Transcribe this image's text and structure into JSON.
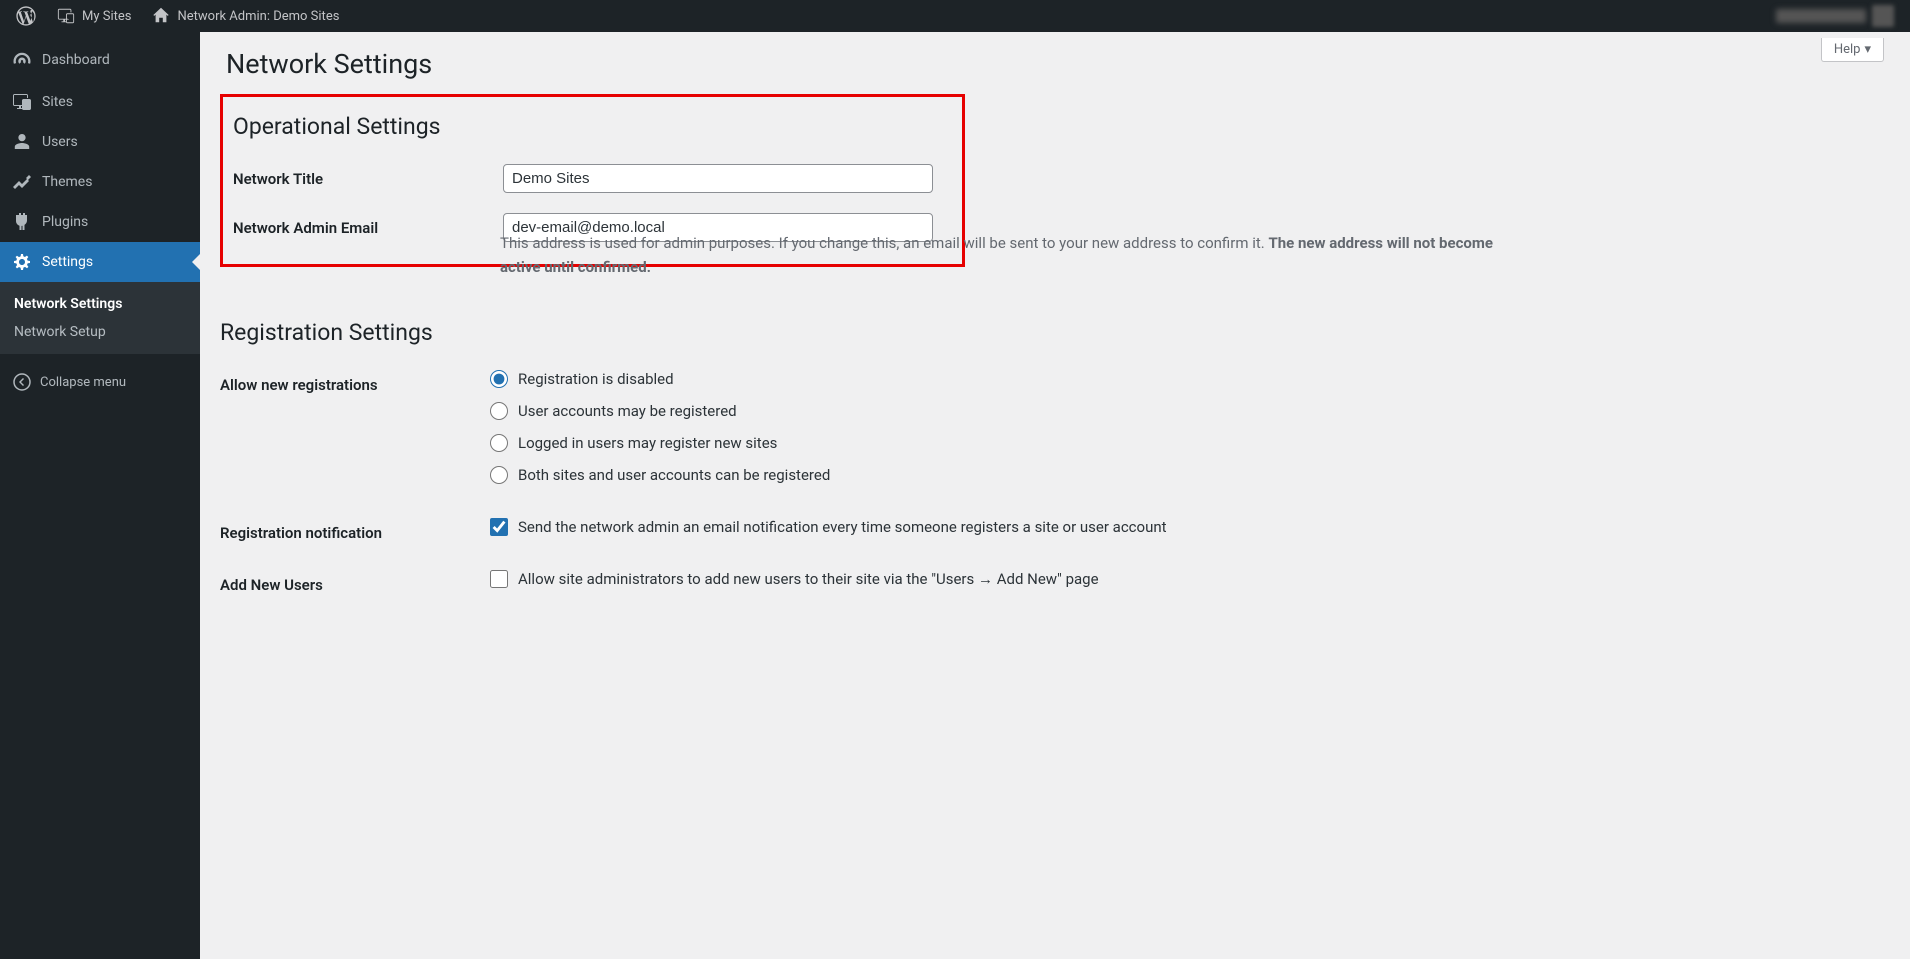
{
  "adminbar": {
    "my_sites": "My Sites",
    "network_admin": "Network Admin: Demo Sites"
  },
  "help_label": "Help",
  "sidebar": {
    "items": [
      {
        "label": "Dashboard"
      },
      {
        "label": "Sites"
      },
      {
        "label": "Users"
      },
      {
        "label": "Themes"
      },
      {
        "label": "Plugins"
      },
      {
        "label": "Settings"
      }
    ],
    "submenu": [
      {
        "label": "Network Settings"
      },
      {
        "label": "Network Setup"
      }
    ],
    "collapse": "Collapse menu"
  },
  "page": {
    "title": "Network Settings",
    "operational": {
      "heading": "Operational Settings",
      "network_title_label": "Network Title",
      "network_title_value": "Demo Sites",
      "admin_email_label": "Network Admin Email",
      "admin_email_value": "dev-email@demo.local",
      "admin_email_desc_1": "This address is used for admin purposes. If you change this, an email will be sent to your new address to confirm it. ",
      "admin_email_desc_2": "The new address will not become active until confirmed."
    },
    "registration": {
      "heading": "Registration Settings",
      "allow_label": "Allow new registrations",
      "options": [
        "Registration is disabled",
        "User accounts may be registered",
        "Logged in users may register new sites",
        "Both sites and user accounts can be registered"
      ],
      "notification_label": "Registration notification",
      "notification_text": "Send the network admin an email notification every time someone registers a site or user account",
      "add_users_label": "Add New Users",
      "add_users_text": "Allow site administrators to add new users to their site via the \"Users → Add New\" page"
    }
  }
}
